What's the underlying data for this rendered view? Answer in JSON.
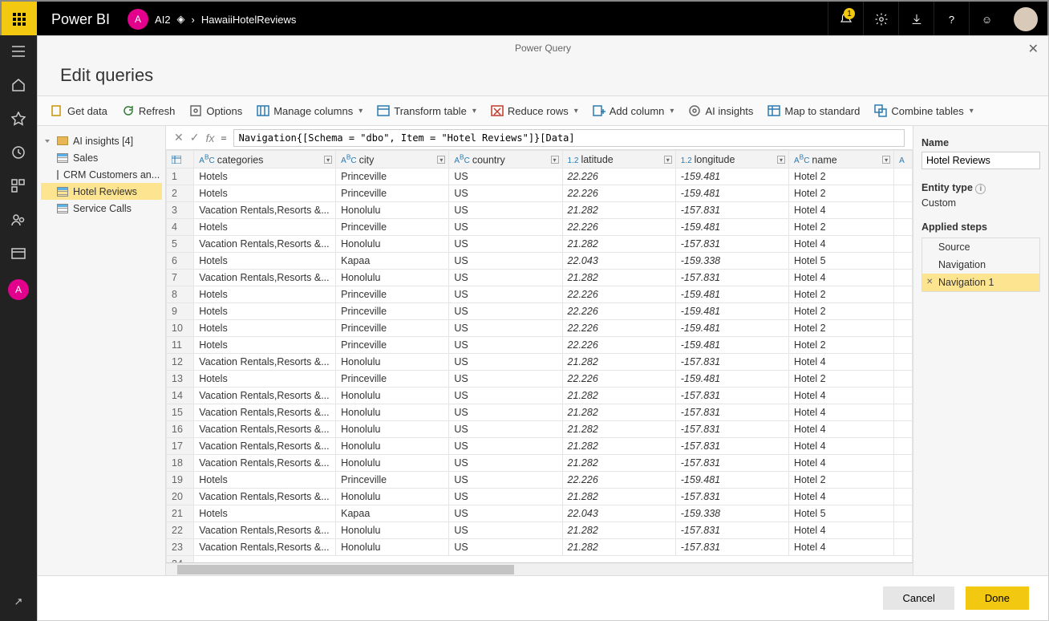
{
  "header": {
    "brand": "Power BI",
    "ws_badge": "A",
    "ws_name": "AI2",
    "breadcrumb": "HawaiiHotelReviews",
    "notif_count": "1"
  },
  "modal": {
    "title": "Power Query",
    "subtitle": "Edit queries"
  },
  "ribbon": {
    "get_data": "Get data",
    "refresh": "Refresh",
    "options": "Options",
    "manage_cols": "Manage columns",
    "transform": "Transform table",
    "reduce": "Reduce rows",
    "add_col": "Add column",
    "ai": "AI insights",
    "map_std": "Map to standard",
    "combine": "Combine tables"
  },
  "queries": {
    "folder": "AI insights  [4]",
    "items": [
      "Sales",
      "CRM Customers an...",
      "Hotel Reviews",
      "Service Calls"
    ],
    "selected": "Hotel Reviews"
  },
  "formula": "Navigation{[Schema = \"dbo\", Item = \"Hotel Reviews\"]}[Data]",
  "columns": [
    {
      "name": "categories",
      "type": "ABC"
    },
    {
      "name": "city",
      "type": "ABC"
    },
    {
      "name": "country",
      "type": "ABC"
    },
    {
      "name": "latitude",
      "type": "1.2"
    },
    {
      "name": "longitude",
      "type": "1.2"
    },
    {
      "name": "name",
      "type": "ABC"
    }
  ],
  "rows": [
    {
      "n": 1,
      "categories": "Hotels",
      "city": "Princeville",
      "country": "US",
      "latitude": "22.226",
      "longitude": "-159.481",
      "name": "Hotel 2"
    },
    {
      "n": 2,
      "categories": "Hotels",
      "city": "Princeville",
      "country": "US",
      "latitude": "22.226",
      "longitude": "-159.481",
      "name": "Hotel 2"
    },
    {
      "n": 3,
      "categories": "Vacation Rentals,Resorts &...",
      "city": "Honolulu",
      "country": "US",
      "latitude": "21.282",
      "longitude": "-157.831",
      "name": "Hotel 4"
    },
    {
      "n": 4,
      "categories": "Hotels",
      "city": "Princeville",
      "country": "US",
      "latitude": "22.226",
      "longitude": "-159.481",
      "name": "Hotel 2"
    },
    {
      "n": 5,
      "categories": "Vacation Rentals,Resorts &...",
      "city": "Honolulu",
      "country": "US",
      "latitude": "21.282",
      "longitude": "-157.831",
      "name": "Hotel 4"
    },
    {
      "n": 6,
      "categories": "Hotels",
      "city": "Kapaa",
      "country": "US",
      "latitude": "22.043",
      "longitude": "-159.338",
      "name": "Hotel 5"
    },
    {
      "n": 7,
      "categories": "Vacation Rentals,Resorts &...",
      "city": "Honolulu",
      "country": "US",
      "latitude": "21.282",
      "longitude": "-157.831",
      "name": "Hotel 4"
    },
    {
      "n": 8,
      "categories": "Hotels",
      "city": "Princeville",
      "country": "US",
      "latitude": "22.226",
      "longitude": "-159.481",
      "name": "Hotel 2"
    },
    {
      "n": 9,
      "categories": "Hotels",
      "city": "Princeville",
      "country": "US",
      "latitude": "22.226",
      "longitude": "-159.481",
      "name": "Hotel 2"
    },
    {
      "n": 10,
      "categories": "Hotels",
      "city": "Princeville",
      "country": "US",
      "latitude": "22.226",
      "longitude": "-159.481",
      "name": "Hotel 2"
    },
    {
      "n": 11,
      "categories": "Hotels",
      "city": "Princeville",
      "country": "US",
      "latitude": "22.226",
      "longitude": "-159.481",
      "name": "Hotel 2"
    },
    {
      "n": 12,
      "categories": "Vacation Rentals,Resorts &...",
      "city": "Honolulu",
      "country": "US",
      "latitude": "21.282",
      "longitude": "-157.831",
      "name": "Hotel 4"
    },
    {
      "n": 13,
      "categories": "Hotels",
      "city": "Princeville",
      "country": "US",
      "latitude": "22.226",
      "longitude": "-159.481",
      "name": "Hotel 2"
    },
    {
      "n": 14,
      "categories": "Vacation Rentals,Resorts &...",
      "city": "Honolulu",
      "country": "US",
      "latitude": "21.282",
      "longitude": "-157.831",
      "name": "Hotel 4"
    },
    {
      "n": 15,
      "categories": "Vacation Rentals,Resorts &...",
      "city": "Honolulu",
      "country": "US",
      "latitude": "21.282",
      "longitude": "-157.831",
      "name": "Hotel 4"
    },
    {
      "n": 16,
      "categories": "Vacation Rentals,Resorts &...",
      "city": "Honolulu",
      "country": "US",
      "latitude": "21.282",
      "longitude": "-157.831",
      "name": "Hotel 4"
    },
    {
      "n": 17,
      "categories": "Vacation Rentals,Resorts &...",
      "city": "Honolulu",
      "country": "US",
      "latitude": "21.282",
      "longitude": "-157.831",
      "name": "Hotel 4"
    },
    {
      "n": 18,
      "categories": "Vacation Rentals,Resorts &...",
      "city": "Honolulu",
      "country": "US",
      "latitude": "21.282",
      "longitude": "-157.831",
      "name": "Hotel 4"
    },
    {
      "n": 19,
      "categories": "Hotels",
      "city": "Princeville",
      "country": "US",
      "latitude": "22.226",
      "longitude": "-159.481",
      "name": "Hotel 2"
    },
    {
      "n": 20,
      "categories": "Vacation Rentals,Resorts &...",
      "city": "Honolulu",
      "country": "US",
      "latitude": "21.282",
      "longitude": "-157.831",
      "name": "Hotel 4"
    },
    {
      "n": 21,
      "categories": "Hotels",
      "city": "Kapaa",
      "country": "US",
      "latitude": "22.043",
      "longitude": "-159.338",
      "name": "Hotel 5"
    },
    {
      "n": 22,
      "categories": "Vacation Rentals,Resorts &...",
      "city": "Honolulu",
      "country": "US",
      "latitude": "21.282",
      "longitude": "-157.831",
      "name": "Hotel 4"
    },
    {
      "n": 23,
      "categories": "Vacation Rentals,Resorts &...",
      "city": "Honolulu",
      "country": "US",
      "latitude": "21.282",
      "longitude": "-157.831",
      "name": "Hotel 4"
    }
  ],
  "props": {
    "name_label": "Name",
    "name_value": "Hotel Reviews",
    "entity_label": "Entity type",
    "entity_value": "Custom",
    "steps_label": "Applied steps",
    "steps": [
      "Source",
      "Navigation",
      "Navigation 1"
    ],
    "selected_step": "Navigation 1"
  },
  "footer": {
    "cancel": "Cancel",
    "done": "Done"
  }
}
